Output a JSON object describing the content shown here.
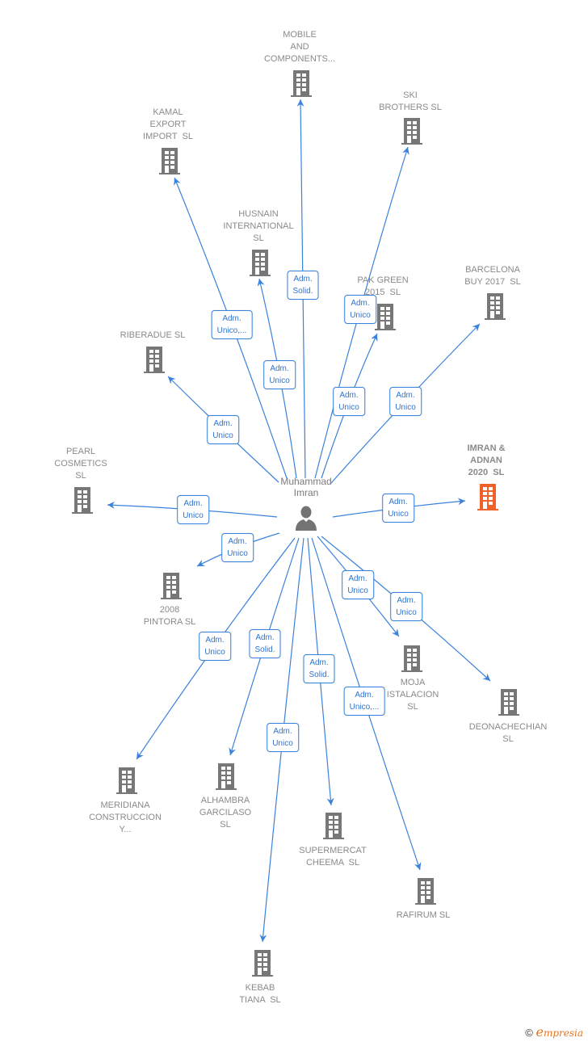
{
  "colors": {
    "edge": "#3b82dc",
    "building_default": "#777777",
    "building_highlight": "#f0622a",
    "label_text": "#8a8a8a"
  },
  "center": {
    "name": "Muhammad\nImran",
    "icon": "person-icon"
  },
  "companies": [
    {
      "id": "mobile",
      "name": "MOBILE\nAND\nCOMPONENTS...",
      "relation": "Adm.\nSolid.",
      "highlight": false,
      "icon": "building-icon"
    },
    {
      "id": "ski",
      "name": "SKI\nBROTHERS SL",
      "relation": "Adm.\nUnico",
      "highlight": false,
      "icon": "building-icon"
    },
    {
      "id": "kamal",
      "name": "KAMAL\nEXPORT\nIMPORT  SL",
      "relation": "Adm.\nUnico,...",
      "highlight": false,
      "icon": "building-icon"
    },
    {
      "id": "husnain",
      "name": "HUSNAIN\nINTERNATIONAL\nSL",
      "relation": "Adm.\nUnico",
      "highlight": false,
      "icon": "building-icon"
    },
    {
      "id": "pakgreen",
      "name": "PAK GREEN\n2015  SL",
      "relation": "Adm.\nUnico",
      "highlight": false,
      "icon": "building-icon"
    },
    {
      "id": "barcelona",
      "name": "BARCELONA\nBUY 2017  SL",
      "relation": "Adm.\nUnico",
      "highlight": false,
      "icon": "building-icon"
    },
    {
      "id": "riberadue",
      "name": "RIBERADUE SL",
      "relation": "Adm.\nUnico",
      "highlight": false,
      "icon": "building-icon"
    },
    {
      "id": "pearl",
      "name": "PEARL\nCOSMETICS\nSL",
      "relation": "Adm.\nUnico",
      "highlight": false,
      "icon": "building-icon"
    },
    {
      "id": "imran",
      "name": "IMRAN &\nADNAN\n2020  SL",
      "relation": "Adm.\nUnico",
      "highlight": true,
      "icon": "building-icon"
    },
    {
      "id": "pintora",
      "name": "2008\nPINTORA SL",
      "relation": "Adm.\nUnico",
      "highlight": false,
      "icon": "building-icon"
    },
    {
      "id": "moja",
      "name": "MOJA\nISTALACION\nSL",
      "relation": "Adm.\nUnico",
      "highlight": false,
      "icon": "building-icon"
    },
    {
      "id": "deona",
      "name": "DEONACHECHIAN\nSL",
      "relation": "Adm.\nUnico",
      "highlight": false,
      "icon": "building-icon"
    },
    {
      "id": "meridiana",
      "name": "MERIDIANA\nCONSTRUCCION\nY...",
      "relation": "Adm.\nUnico",
      "highlight": false,
      "icon": "building-icon"
    },
    {
      "id": "alhambra",
      "name": "ALHAMBRA\nGARCILASO\nSL",
      "relation": "Adm.\nSolid.",
      "highlight": false,
      "icon": "building-icon"
    },
    {
      "id": "supermercat",
      "name": "SUPERMERCAT\nCHEEMA  SL",
      "relation": "Adm.\nSolid.",
      "highlight": false,
      "icon": "building-icon"
    },
    {
      "id": "rafirum",
      "name": "RAFIRUM SL",
      "relation": "Adm.\nUnico,...",
      "highlight": false,
      "icon": "building-icon"
    },
    {
      "id": "kebab",
      "name": "KEBAB\nTIANA  SL",
      "relation": "Adm.\nUnico",
      "highlight": false,
      "icon": "building-icon"
    }
  ],
  "footer": {
    "copyright": "©",
    "brand": "mpresia",
    "brand_initial": "e"
  }
}
